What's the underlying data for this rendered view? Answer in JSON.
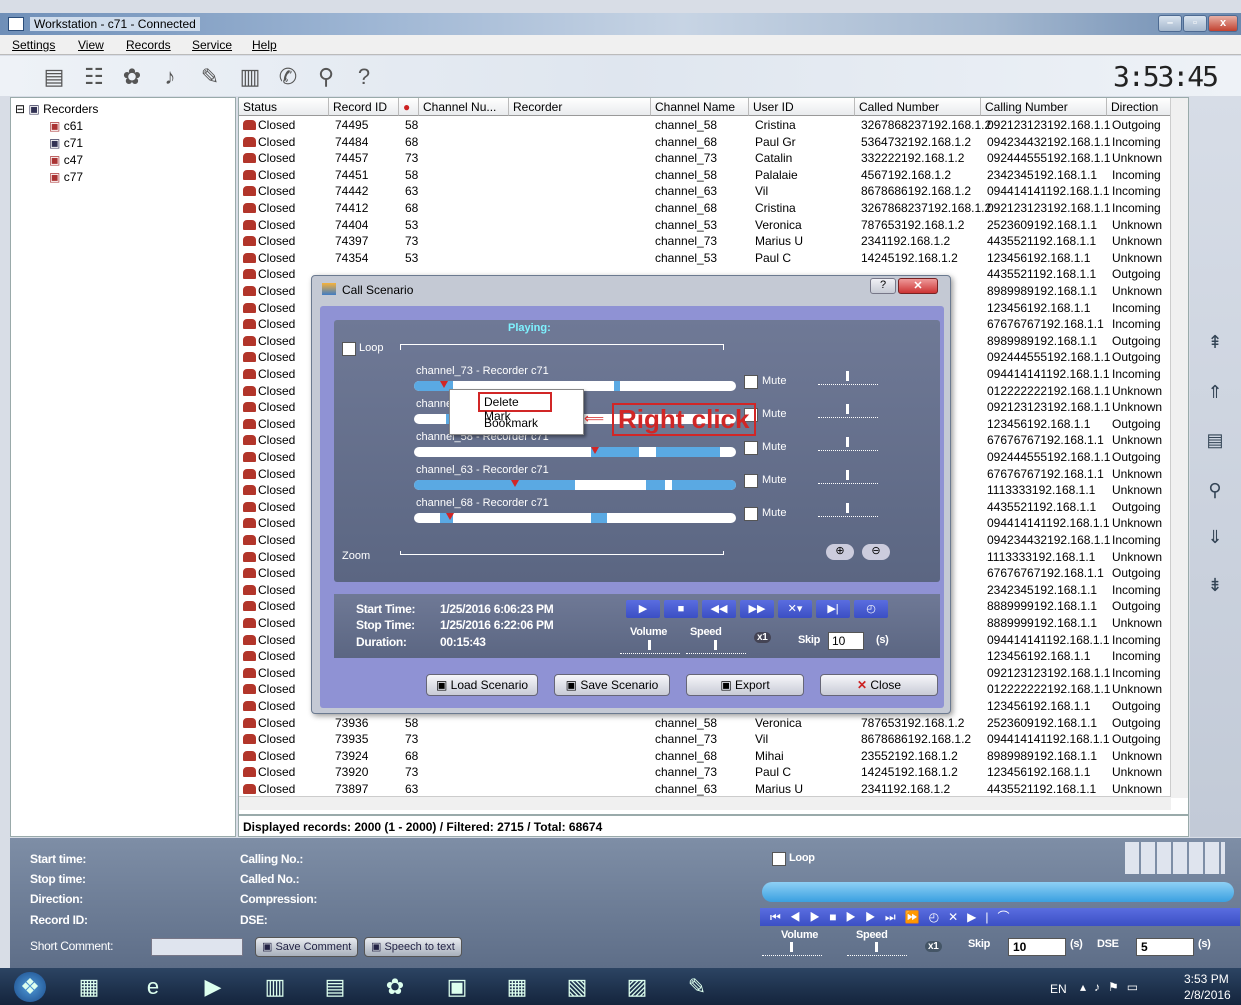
{
  "window": {
    "title": "Workstation - c71 - Connected",
    "min": "–",
    "max": "▫",
    "close": "x"
  },
  "menu": [
    "Settings",
    "View",
    "Records",
    "Service",
    "Help"
  ],
  "clock": "3:53:45",
  "tree": {
    "root": "Recorders",
    "items": [
      "c61",
      "c71",
      "c47",
      "c77"
    ]
  },
  "columns": [
    "Status",
    "Record ID",
    "●",
    "Channel Nu...",
    "Recorder",
    "Channel Name",
    "User ID",
    "Called Number",
    "Calling Number",
    "Direction"
  ],
  "rows": [
    [
      "Closed",
      "74495",
      "58",
      "",
      "channel_58",
      "Cristina",
      "3267868237192.168.1.2",
      "092123123192.168.1.1",
      "Outgoing"
    ],
    [
      "Closed",
      "74484",
      "68",
      "",
      "channel_68",
      "Paul Gr",
      "5364732192.168.1.2",
      "094234432192.168.1.1",
      "Incoming"
    ],
    [
      "Closed",
      "74457",
      "73",
      "",
      "channel_73",
      "Catalin",
      "332222192.168.1.2",
      "092444555192.168.1.1",
      "Unknown"
    ],
    [
      "Closed",
      "74451",
      "58",
      "",
      "channel_58",
      "Palalaie",
      "4567192.168.1.2",
      "2342345192.168.1.1",
      "Incoming"
    ],
    [
      "Closed",
      "74442",
      "63",
      "",
      "channel_63",
      "Vil",
      "8678686192.168.1.2",
      "094414141192.168.1.1",
      "Incoming"
    ],
    [
      "Closed",
      "74412",
      "68",
      "",
      "channel_68",
      "Cristina",
      "3267868237192.168.1.2",
      "092123123192.168.1.1",
      "Incoming"
    ],
    [
      "Closed",
      "74404",
      "53",
      "",
      "channel_53",
      "Veronica",
      "787653192.168.1.2",
      "2523609192.168.1.1",
      "Unknown"
    ],
    [
      "Closed",
      "74397",
      "73",
      "",
      "channel_73",
      "Marius U",
      "2341192.168.1.2",
      "4435521192.168.1.1",
      "Unknown"
    ],
    [
      "Closed",
      "74354",
      "53",
      "",
      "channel_53",
      "Paul C",
      "14245192.168.1.2",
      "123456192.168.1.1",
      "Unknown"
    ],
    [
      "Closed",
      "",
      "",
      "",
      "",
      "",
      "",
      "4435521192.168.1.1",
      "Outgoing"
    ],
    [
      "Closed",
      "",
      "",
      "",
      "",
      "",
      "",
      "8989989192.168.1.1",
      "Unknown"
    ],
    [
      "Closed",
      "",
      "",
      "",
      "",
      "",
      "",
      "123456192.168.1.1",
      "Incoming"
    ],
    [
      "Closed",
      "",
      "",
      "",
      "",
      "",
      "",
      "67676767192.168.1.1",
      "Incoming"
    ],
    [
      "Closed",
      "",
      "",
      "",
      "",
      "",
      "",
      "8989989192.168.1.1",
      "Outgoing"
    ],
    [
      "Closed",
      "",
      "",
      "",
      "",
      "",
      "",
      "092444555192.168.1.1",
      "Outgoing"
    ],
    [
      "Closed",
      "",
      "",
      "",
      "",
      "",
      "",
      "094414141192.168.1.1",
      "Incoming"
    ],
    [
      "Closed",
      "",
      "",
      "",
      "",
      "",
      "",
      "012222222192.168.1.1",
      "Unknown"
    ],
    [
      "Closed",
      "",
      "",
      "",
      "",
      "",
      "",
      "092123123192.168.1.1",
      "Unknown"
    ],
    [
      "Closed",
      "",
      "",
      "",
      "",
      "",
      "",
      "123456192.168.1.1",
      "Outgoing"
    ],
    [
      "Closed",
      "",
      "",
      "",
      "",
      "",
      "",
      "67676767192.168.1.1",
      "Unknown"
    ],
    [
      "Closed",
      "",
      "",
      "",
      "",
      "",
      "",
      "092444555192.168.1.1",
      "Outgoing"
    ],
    [
      "Closed",
      "",
      "",
      "",
      "",
      "",
      "",
      "67676767192.168.1.1",
      "Unknown"
    ],
    [
      "Closed",
      "",
      "",
      "",
      "",
      "",
      "",
      "1113333192.168.1.1",
      "Unknown"
    ],
    [
      "Closed",
      "",
      "",
      "",
      "",
      "",
      "",
      "4435521192.168.1.1",
      "Outgoing"
    ],
    [
      "Closed",
      "",
      "",
      "",
      "",
      "",
      "",
      "094414141192.168.1.1",
      "Unknown"
    ],
    [
      "Closed",
      "",
      "",
      "",
      "",
      "",
      "",
      "094234432192.168.1.1",
      "Incoming"
    ],
    [
      "Closed",
      "",
      "",
      "",
      "",
      "",
      "",
      "1113333192.168.1.1",
      "Unknown"
    ],
    [
      "Closed",
      "",
      "",
      "",
      "",
      "",
      "",
      "67676767192.168.1.1",
      "Outgoing"
    ],
    [
      "Closed",
      "",
      "",
      "",
      "",
      "",
      "",
      "2342345192.168.1.1",
      "Incoming"
    ],
    [
      "Closed",
      "",
      "",
      "",
      "",
      "",
      "",
      "8889999192.168.1.1",
      "Outgoing"
    ],
    [
      "Closed",
      "",
      "",
      "",
      "",
      "",
      "",
      "8889999192.168.1.1",
      "Unknown"
    ],
    [
      "Closed",
      "",
      "",
      "",
      "",
      "",
      "",
      "094414141192.168.1.1",
      "Incoming"
    ],
    [
      "Closed",
      "",
      "",
      "",
      "",
      "",
      "",
      "123456192.168.1.1",
      "Incoming"
    ],
    [
      "Closed",
      "",
      "",
      "",
      "",
      "",
      "",
      "092123123192.168.1.1",
      "Incoming"
    ],
    [
      "Closed",
      "",
      "",
      "",
      "",
      "",
      "",
      "012222222192.168.1.1",
      "Unknown"
    ],
    [
      "Closed",
      "",
      "",
      "",
      "",
      "",
      "",
      "123456192.168.1.1",
      "Outgoing"
    ],
    [
      "Closed",
      "73936",
      "58",
      "",
      "channel_58",
      "Veronica",
      "787653192.168.1.2",
      "2523609192.168.1.1",
      "Outgoing"
    ],
    [
      "Closed",
      "73935",
      "73",
      "",
      "channel_73",
      "Vil",
      "8678686192.168.1.2",
      "094414141192.168.1.1",
      "Outgoing"
    ],
    [
      "Closed",
      "73924",
      "68",
      "",
      "channel_68",
      "Mihai",
      "23552192.168.1.2",
      "8989989192.168.1.1",
      "Unknown"
    ],
    [
      "Closed",
      "73920",
      "73",
      "",
      "channel_73",
      "Paul C",
      "14245192.168.1.2",
      "123456192.168.1.1",
      "Unknown"
    ],
    [
      "Closed",
      "73897",
      "63",
      "",
      "channel_63",
      "Marius U",
      "2341192.168.1.2",
      "4435521192.168.1.1",
      "Unknown"
    ]
  ],
  "status": "Displayed records: 2000 (1 - 2000) / Filtered: 2715 / Total: 68674",
  "dialog": {
    "title": "Call Scenario",
    "playing": "Playing:",
    "loop": "Loop",
    "zoom": "Zoom",
    "mute": "Mute",
    "tracks": [
      {
        "label": "channel_73 - Recorder c71",
        "fill": 0.08
      },
      {
        "label": "channel_5",
        "fill": 0.12
      },
      {
        "label": "channel_58 - Recorder c71",
        "fill": 0.55
      },
      {
        "label": "channel_63 - Recorder c71",
        "fill": 0.3
      },
      {
        "label": "channel_68 - Recorder c71",
        "fill": 0.1
      }
    ],
    "start_label": "Start Time:",
    "start": "1/25/2016 6:06:23 PM",
    "stop_label": "Stop Time:",
    "stop": "1/25/2016 6:22:06 PM",
    "dur_label": "Duration:",
    "dur": "00:15:43",
    "volume": "Volume",
    "speed": "Speed",
    "x1": "x1",
    "skip": "Skip",
    "skip_val": "10",
    "skip_unit": "(s)",
    "buttons": [
      "Load Scenario",
      "Save Scenario",
      "Export",
      "Close"
    ]
  },
  "context_menu": [
    "Delete Mark",
    "Bookmark"
  ],
  "annotation": "Right click",
  "bottom": {
    "left_labels": [
      "Start time:",
      "Stop time:",
      "Direction:",
      "Record ID:"
    ],
    "mid_labels": [
      "Calling No.:",
      "Called No.:",
      "Compression:",
      "DSE:"
    ],
    "short_comment": "Short Comment:",
    "save_comment": "Save Comment",
    "speech": "Speech to text",
    "loop": "Loop",
    "volume": "Volume",
    "speed": "Speed",
    "x1": "x1",
    "skip": "Skip",
    "skip_val": "10",
    "s1": "(s)",
    "dse": "DSE",
    "dse_val": "5",
    "s2": "(s)"
  },
  "taskbar": {
    "lang": "EN",
    "time": "3:53 PM",
    "date": "2/8/2016"
  }
}
